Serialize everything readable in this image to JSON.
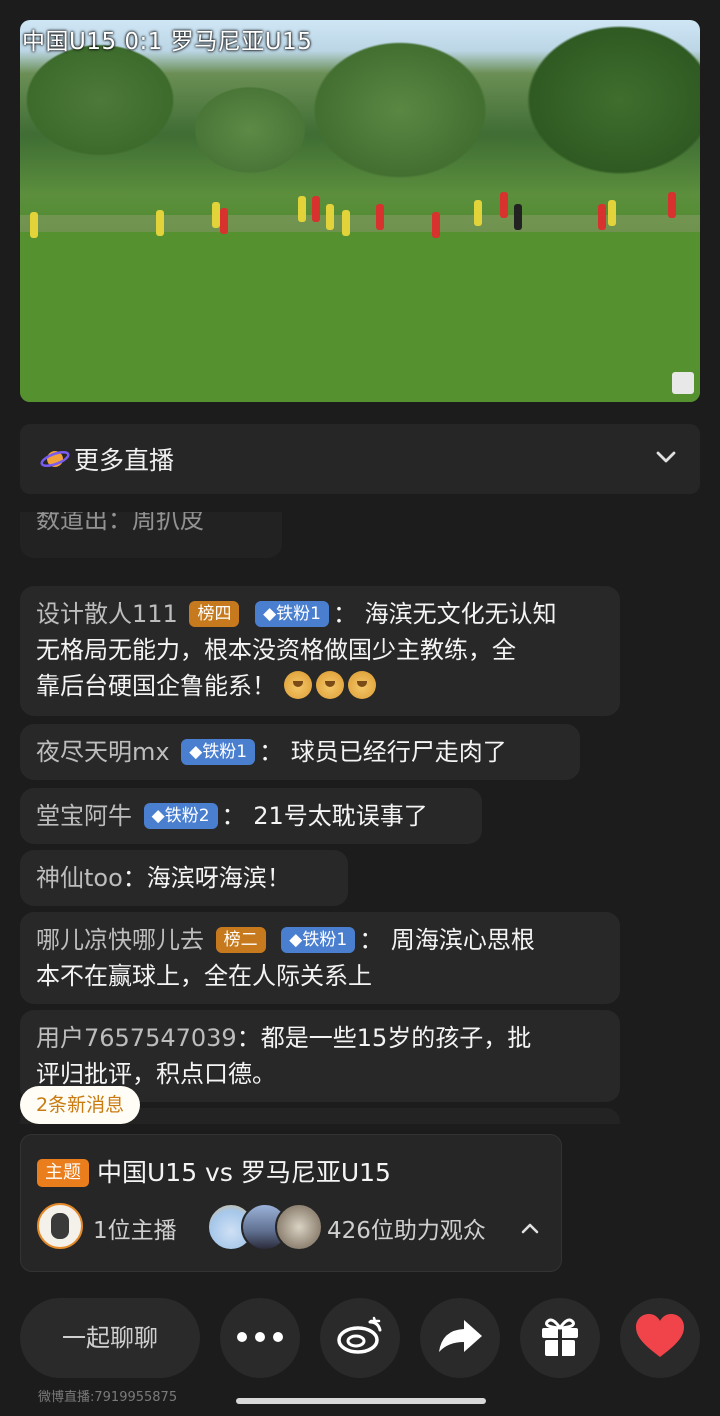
{
  "video": {
    "overlay_text": "中国U15 0:1 罗马尼亚U15"
  },
  "more_live": {
    "label": "更多直播",
    "icon": "planet-icon",
    "chevron": "chevron-down-icon"
  },
  "chat": {
    "partial_top": "数道出：周扒皮",
    "messages": [
      {
        "user": "设计散人111",
        "rank_badge": "榜四",
        "fan_badge": "铁粉1",
        "line1": "海滨无文化无认知",
        "line2": "无格局无能力，根本没资格做国少主教练，全",
        "line3": "靠后台硬国企鲁能系！"
      },
      {
        "user": "夜尽天明mx",
        "fan_badge": "铁粉1",
        "text": "球员已经行尸走肉了"
      },
      {
        "user": "堂宝阿牛",
        "fan_badge": "铁粉2",
        "text": "21号太耽误事了"
      },
      {
        "user": "神仙too",
        "text": "海滨呀海滨！"
      },
      {
        "user": "哪儿凉快哪儿去",
        "rank_badge": "榜二",
        "fan_badge": "铁粉1",
        "line1": "周海滨心思根",
        "line2": "本不在赢球上，全在人际关系上"
      },
      {
        "user": "用户7657547039",
        "line1": "都是一些15岁的孩子，批",
        "line2": "评归批评，积点口德。"
      }
    ],
    "colon": "："
  },
  "new_messages": "2条新消息",
  "topic": {
    "tag": "主题",
    "title": "中国U15 vs 罗马尼亚U15",
    "host_count": "1位主播",
    "viewer_count": "426位助力观众"
  },
  "bottom": {
    "chat_placeholder": "一起聊聊",
    "buttons": [
      "more-icon",
      "weibo-icon",
      "share-icon",
      "gift-icon",
      "heart-icon"
    ]
  },
  "footer": {
    "id_text": "微博直播:7919955875"
  },
  "colors": {
    "background": "#1c1c1c",
    "rank_badge": "#c77a1d",
    "fan_badge": "#4a7fd0",
    "topic_tag": "#ea7d1c",
    "heart": "#f0434a",
    "new_msg_text": "#c97b12"
  }
}
